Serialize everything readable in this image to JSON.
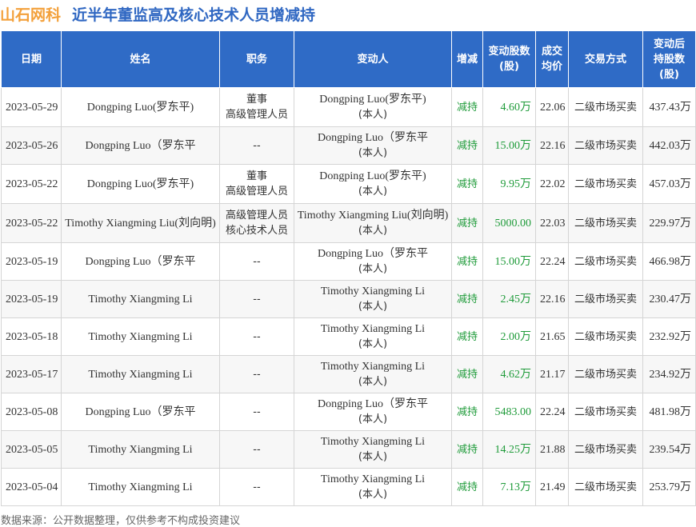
{
  "header": {
    "brand": "山石网科",
    "title": "近半年董监高及核心技术人员增减持"
  },
  "columns": [
    "日期",
    "姓名",
    "职务",
    "变动人",
    "增减",
    "变动股数\n(股)",
    "成交\n均价",
    "交易方式",
    "变动后\n持股数\n(股)"
  ],
  "rows": [
    {
      "date": "2023-05-29",
      "name": "Dongping Luo(罗东平)",
      "position": [
        "董事",
        "高级管理人员"
      ],
      "changer": "Dongping Luo(罗东平)",
      "changer_note": "(本人)",
      "direction": "减持",
      "amount": "4.60万",
      "price": "22.06",
      "method": "二级市场买卖",
      "after": "437.43万"
    },
    {
      "date": "2023-05-26",
      "name": "Dongping Luo（罗东平",
      "position": [
        "--"
      ],
      "changer": "Dongping Luo（罗东平",
      "changer_note": "(本人)",
      "direction": "减持",
      "amount": "15.00万",
      "price": "22.16",
      "method": "二级市场买卖",
      "after": "442.03万"
    },
    {
      "date": "2023-05-22",
      "name": "Dongping Luo(罗东平)",
      "position": [
        "董事",
        "高级管理人员"
      ],
      "changer": "Dongping Luo(罗东平)",
      "changer_note": "(本人)",
      "direction": "减持",
      "amount": "9.95万",
      "price": "22.02",
      "method": "二级市场买卖",
      "after": "457.03万"
    },
    {
      "date": "2023-05-22",
      "name": "Timothy Xiangming Liu(刘向明)",
      "position": [
        "高级管理人员",
        "核心技术人员"
      ],
      "changer": "Timothy Xiangming Liu(刘向明)",
      "changer_note": "(本人)",
      "direction": "减持",
      "amount": "5000.00",
      "price": "22.03",
      "method": "二级市场买卖",
      "after": "229.97万"
    },
    {
      "date": "2023-05-19",
      "name": "Dongping Luo（罗东平",
      "position": [
        "--"
      ],
      "changer": "Dongping Luo（罗东平",
      "changer_note": "(本人)",
      "direction": "减持",
      "amount": "15.00万",
      "price": "22.24",
      "method": "二级市场买卖",
      "after": "466.98万"
    },
    {
      "date": "2023-05-19",
      "name": "Timothy Xiangming Li",
      "position": [
        "--"
      ],
      "changer": "Timothy Xiangming Li",
      "changer_note": "(本人)",
      "direction": "减持",
      "amount": "2.45万",
      "price": "22.16",
      "method": "二级市场买卖",
      "after": "230.47万"
    },
    {
      "date": "2023-05-18",
      "name": "Timothy Xiangming Li",
      "position": [
        "--"
      ],
      "changer": "Timothy Xiangming Li",
      "changer_note": "(本人)",
      "direction": "减持",
      "amount": "2.00万",
      "price": "21.65",
      "method": "二级市场买卖",
      "after": "232.92万"
    },
    {
      "date": "2023-05-17",
      "name": "Timothy Xiangming Li",
      "position": [
        "--"
      ],
      "changer": "Timothy Xiangming Li",
      "changer_note": "(本人)",
      "direction": "减持",
      "amount": "4.62万",
      "price": "21.17",
      "method": "二级市场买卖",
      "after": "234.92万"
    },
    {
      "date": "2023-05-08",
      "name": "Dongping Luo（罗东平",
      "position": [
        "--"
      ],
      "changer": "Dongping Luo（罗东平",
      "changer_note": "(本人)",
      "direction": "减持",
      "amount": "5483.00",
      "price": "22.24",
      "method": "二级市场买卖",
      "after": "481.98万"
    },
    {
      "date": "2023-05-05",
      "name": "Timothy Xiangming Li",
      "position": [
        "--"
      ],
      "changer": "Timothy Xiangming Li",
      "changer_note": "(本人)",
      "direction": "减持",
      "amount": "14.25万",
      "price": "21.88",
      "method": "二级市场买卖",
      "after": "239.54万"
    },
    {
      "date": "2023-05-04",
      "name": "Timothy Xiangming Li",
      "position": [
        "--"
      ],
      "changer": "Timothy Xiangming Li",
      "changer_note": "(本人)",
      "direction": "减持",
      "amount": "7.13万",
      "price": "21.49",
      "method": "二级市场买卖",
      "after": "253.79万"
    }
  ],
  "footer": "数据来源：公开数据整理，仅供参考不构成投资建议",
  "colors": {
    "header_bg": "#2f6bc6",
    "title": "#2f67c2",
    "brand": "#f3a03a",
    "decrease": "#1f9b3a"
  }
}
